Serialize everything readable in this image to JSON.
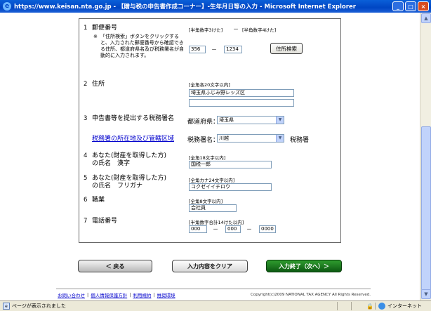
{
  "window": {
    "title": "https://www.keisan.nta.go.jp - 【贈与税の申告書作成コーナー】-生年月日等の入力 - Microsoft Internet Explorer",
    "icon": "ie-icon",
    "controls": {
      "minimize": "_",
      "maximize": "□",
      "close": "×"
    }
  },
  "form": {
    "postal": {
      "num": "1",
      "label": "郵便番号",
      "note_mark": "※",
      "note": "「住所検索」ボタンをクリックすると、入力された郵便番号から確認できる住所、都道府県名及び税務署名が自動的に入力されます。",
      "hint1": "[半角数字3けた]",
      "hint2": "[半角数字4けた]",
      "value1": "356",
      "value2": "1234",
      "dash": "－",
      "search_button": "住所検索"
    },
    "address": {
      "num": "2",
      "label": "住所",
      "hint": "[全角各20文字以内]",
      "value1": "埼玉県ふじみ野レッズ区",
      "value2": ""
    },
    "tax_office": {
      "num": "3",
      "label": "申告書等を提出する税務署名",
      "prefecture_label": "都道府県：",
      "prefecture_value": "埼玉県",
      "office_link": "税務署の所在地及び管轄区域",
      "office_label": "税務署名：",
      "office_value": "川越",
      "office_suffix": "税務署"
    },
    "name_kanji": {
      "num": "4",
      "label_line1": "あなた(財産を取得した方)",
      "label_line2": "の氏名　漢字",
      "hint": "[全角18文字以内]",
      "value": "国税一郎"
    },
    "name_kana": {
      "num": "5",
      "label_line1": "あなた(財産を取得した方)",
      "label_line2": "の氏名　フリガナ",
      "hint": "[全角カナ24文字以内]",
      "value": "コクゼイイチロウ"
    },
    "occupation": {
      "num": "6",
      "label": "職業",
      "hint": "[全角8文字以内]",
      "value": "会社員"
    },
    "phone": {
      "num": "7",
      "label": "電話番号",
      "hint": "[半角数字合計14けた以内]",
      "value1": "000",
      "value2": "000",
      "value3": "0000",
      "dash": "－"
    }
  },
  "buttons": {
    "back": "＜ 戻る",
    "clear": "入力内容をクリア",
    "next": "入力終了（次へ）＞"
  },
  "footer": {
    "links": [
      "お問い合わせ",
      "個人情報保護方針",
      "利用規約",
      "推奨環境"
    ],
    "copyright": "Copyright(c)2009 NATIONAL TAX AGENCY All Rights Reserved."
  },
  "statusbar": {
    "text": "ページが表示されました",
    "zone": "インターネット"
  },
  "colors": {
    "titlebar": "#0046c4",
    "next_button": "#0d5a12",
    "link": "#0000cc"
  }
}
